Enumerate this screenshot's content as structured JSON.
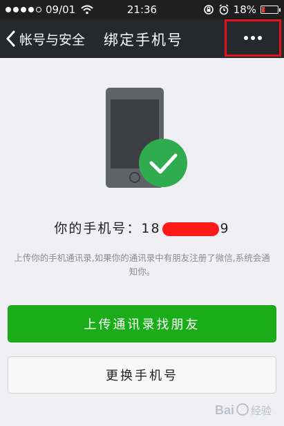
{
  "status_bar": {
    "date": "09/01",
    "time": "21:36",
    "battery": "18%"
  },
  "nav": {
    "back_label": "帐号与安全",
    "title": "绑定手机号"
  },
  "phone": {
    "label": "你的手机号：",
    "prefix": "18",
    "suffix": "9"
  },
  "description": "上传你的手机通讯录,如果你的通讯录中有朋友注册了微信,系统会通知你。",
  "buttons": {
    "upload": "上传通讯录找朋友",
    "change": "更换手机号"
  },
  "watermark": "Bai 经验",
  "colors": {
    "nav_background": "#26292c",
    "status_background": "#1f1f1f",
    "primary_green": "#1aad19",
    "highlight_red": "#e8131f",
    "page_background": "#efeff4"
  }
}
